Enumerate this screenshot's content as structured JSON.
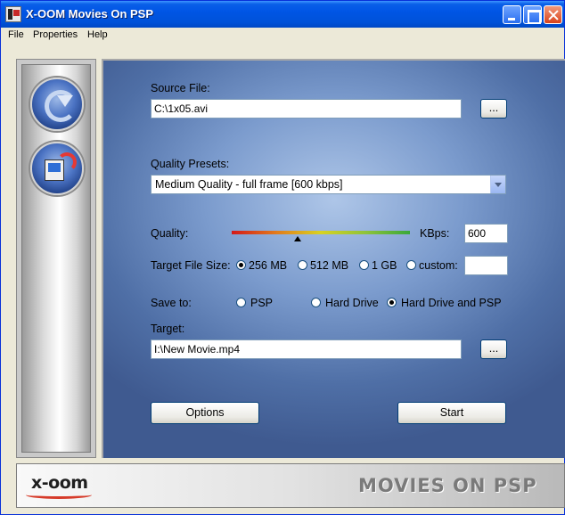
{
  "window": {
    "title": "X-OOM Movies On PSP"
  },
  "menu": [
    "File",
    "Properties",
    "Help"
  ],
  "sidebar": {
    "buttons": [
      {
        "icon": "convert-arrow-icon"
      },
      {
        "icon": "movie-to-psp-icon"
      }
    ]
  },
  "form": {
    "source_label": "Source File:",
    "source_value": "C:\\1x05.avi",
    "browse_label": "...",
    "presets_label": "Quality Presets:",
    "presets_selected": "Medium Quality - full frame [600 kbps]",
    "quality_label": "Quality:",
    "quality_level": 0.37,
    "kbps_label": "KBps:",
    "kbps_value": "600",
    "size_label": "Target File Size:",
    "size_options": [
      "256 MB",
      "512 MB",
      "1 GB",
      "custom:"
    ],
    "size_selected": 0,
    "custom_value": "",
    "save_label": "Save to:",
    "save_options": [
      "PSP",
      "Hard Drive",
      "Hard Drive and PSP"
    ],
    "save_selected": 2,
    "target_label": "Target:",
    "target_value": "I:\\New Movie.mp4",
    "options_label": "Options",
    "start_label": "Start"
  },
  "footer": {
    "logo": "x-oom",
    "title": "MOVIES ON PSP"
  },
  "colors": {
    "titlebar": "#0055e5",
    "panel_center": "#aec6e8",
    "panel_edge": "#3f5a90"
  }
}
